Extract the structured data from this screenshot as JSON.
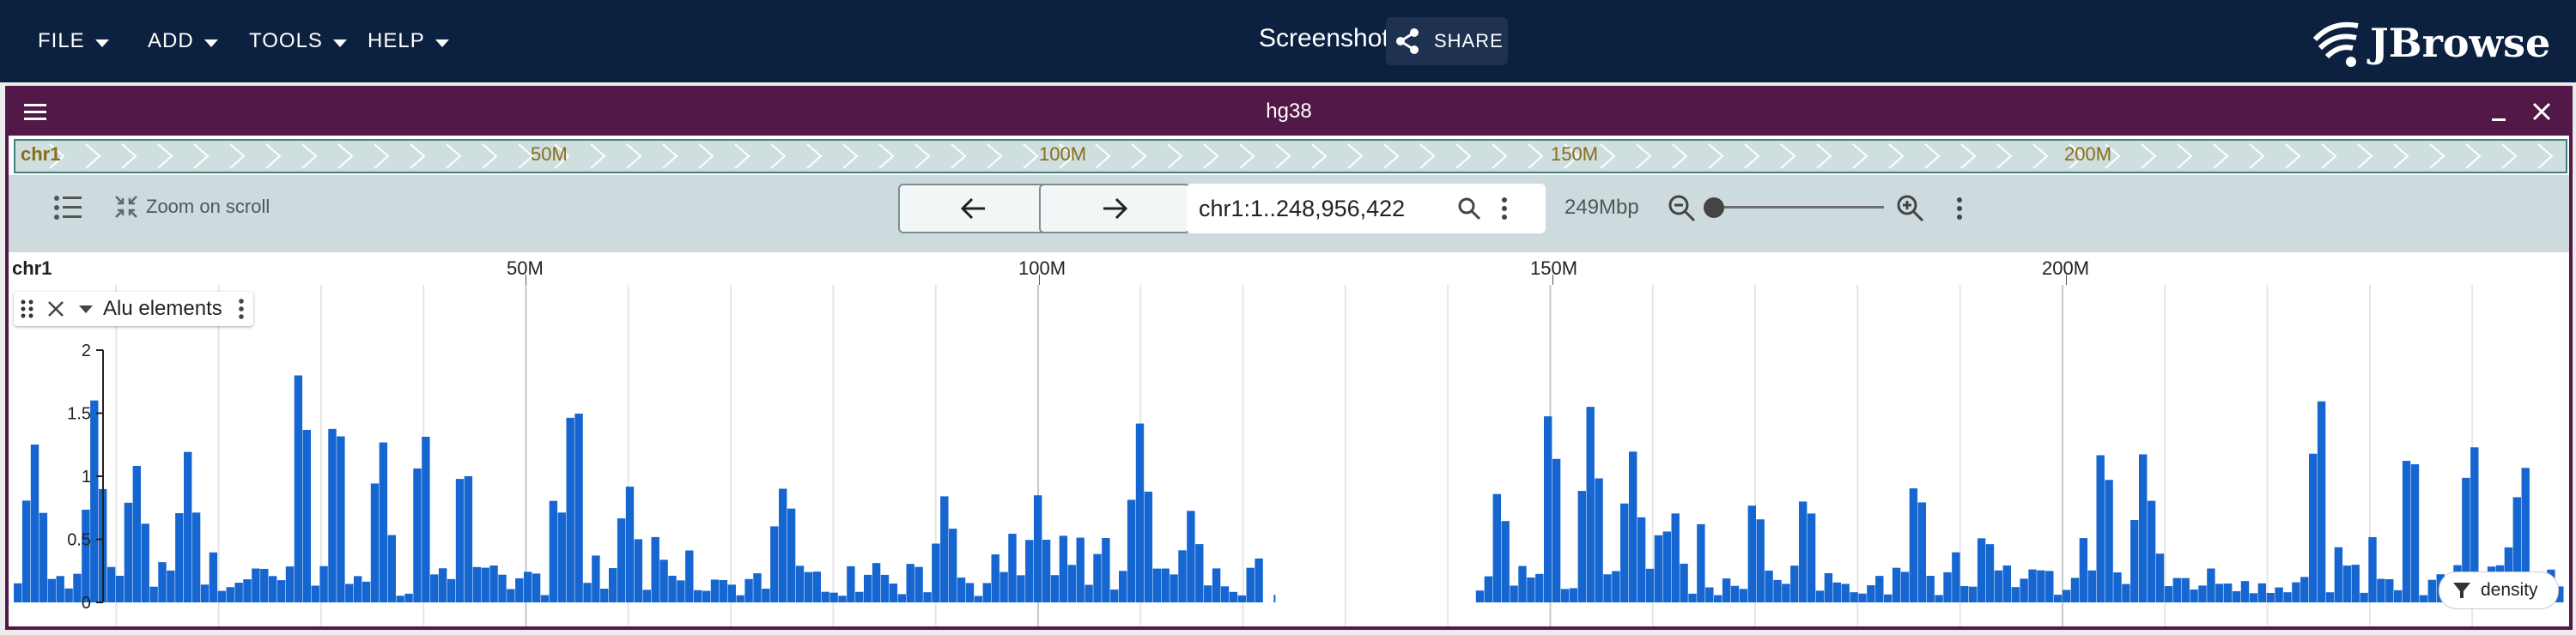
{
  "topbar": {
    "menus": [
      {
        "label": "FILE"
      },
      {
        "label": "ADD"
      },
      {
        "label": "TOOLS"
      },
      {
        "label": "HELP"
      }
    ],
    "session_title": "Screenshot",
    "share_label": "SHARE",
    "logo_text": "JBrowse",
    "background_color": "#0c213f"
  },
  "view": {
    "title": "hg38",
    "header_color": "#521847",
    "overview": {
      "chromosome": "chr1",
      "labels": [
        {
          "text": "50M",
          "value": 50000000
        },
        {
          "text": "100M",
          "value": 100000000
        },
        {
          "text": "150M",
          "value": 150000000
        },
        {
          "text": "200M",
          "value": 200000000
        }
      ]
    },
    "toolbar": {
      "zoom_on_scroll_label": "Zoom on scroll",
      "location": "chr1:1..248,956,422",
      "bp_per_view": "249Mbp",
      "zoom_level_fraction": 0.0
    },
    "ruler": {
      "chromosome": "chr1",
      "labels": [
        {
          "text": "50M",
          "value": 50000000
        },
        {
          "text": "100M",
          "value": 100000000
        },
        {
          "text": "150M",
          "value": 150000000
        },
        {
          "text": "200M",
          "value": 200000000
        }
      ]
    },
    "track": {
      "name": "Alu elements",
      "y_ticks": [
        "0",
        "0.5",
        "1",
        "1.5",
        "2"
      ],
      "display_mode_label": "density",
      "bar_color": "#1566d0"
    }
  },
  "chart_data": {
    "type": "bar",
    "title": "",
    "xlabel": "",
    "ylabel": "",
    "xlim": [
      1,
      248956422
    ],
    "ylim": [
      0,
      2
    ],
    "bin_count": 300,
    "gap_range": [
      122000000,
      143000000
    ],
    "peaks": [
      {
        "x": 2000000,
        "y": 1.3
      },
      {
        "x": 8000000,
        "y": 1.4
      },
      {
        "x": 12000000,
        "y": 1.1
      },
      {
        "x": 17000000,
        "y": 1.2
      },
      {
        "x": 28000000,
        "y": 2.0
      },
      {
        "x": 31500000,
        "y": 1.7
      },
      {
        "x": 36000000,
        "y": 1.0
      },
      {
        "x": 40000000,
        "y": 1.5
      },
      {
        "x": 44000000,
        "y": 1.25
      },
      {
        "x": 53000000,
        "y": 0.95
      },
      {
        "x": 55000000,
        "y": 1.65
      },
      {
        "x": 60000000,
        "y": 1.0
      },
      {
        "x": 75000000,
        "y": 0.95
      },
      {
        "x": 91000000,
        "y": 0.9
      },
      {
        "x": 100000000,
        "y": 0.85
      },
      {
        "x": 110000000,
        "y": 1.45
      },
      {
        "x": 115000000,
        "y": 0.75
      },
      {
        "x": 145000000,
        "y": 0.95
      },
      {
        "x": 150000000,
        "y": 1.65
      },
      {
        "x": 154000000,
        "y": 1.6
      },
      {
        "x": 158000000,
        "y": 1.25
      },
      {
        "x": 162000000,
        "y": 0.8
      },
      {
        "x": 170000000,
        "y": 0.9
      },
      {
        "x": 175000000,
        "y": 0.95
      },
      {
        "x": 186000000,
        "y": 0.85
      },
      {
        "x": 204000000,
        "y": 1.35
      },
      {
        "x": 208000000,
        "y": 1.25
      },
      {
        "x": 225000000,
        "y": 1.6
      },
      {
        "x": 234000000,
        "y": 1.4
      },
      {
        "x": 240000000,
        "y": 1.4
      },
      {
        "x": 245000000,
        "y": 1.2
      }
    ]
  }
}
